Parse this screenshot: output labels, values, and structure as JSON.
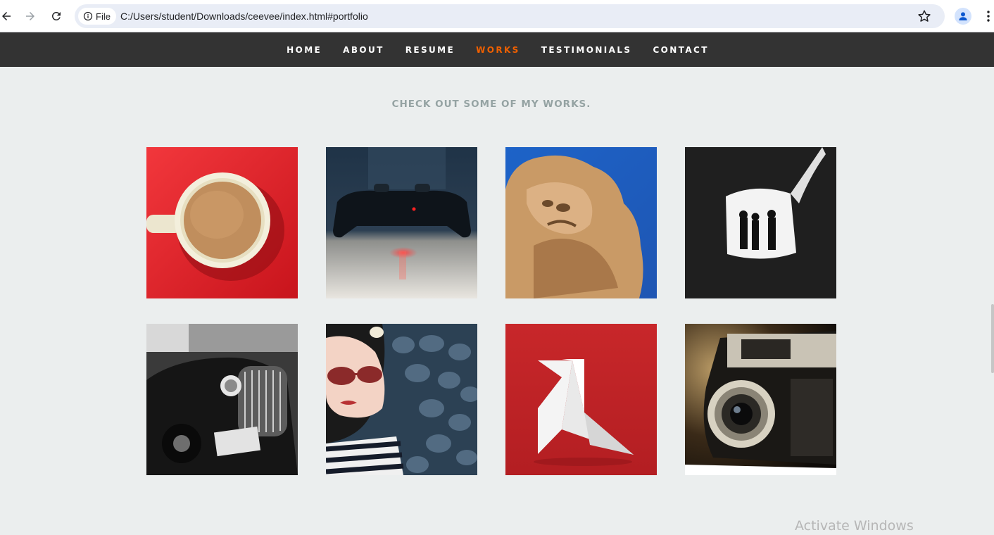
{
  "browser": {
    "chip_label": "File",
    "url": "C:/Users/student/Downloads/ceevee/index.html#portfolio"
  },
  "nav": {
    "items": [
      {
        "label": "Home",
        "active": false
      },
      {
        "label": "About",
        "active": false
      },
      {
        "label": "Resume",
        "active": false
      },
      {
        "label": "Works",
        "active": true
      },
      {
        "label": "Testimonials",
        "active": false
      },
      {
        "label": "Contact",
        "active": false
      }
    ],
    "accent_color": "#f06000"
  },
  "portfolio": {
    "heading": "CHECK OUT SOME OF MY WORKS.",
    "items": [
      {
        "name": "coffee"
      },
      {
        "name": "console"
      },
      {
        "name": "judah"
      },
      {
        "name": "into-the-light"
      },
      {
        "name": "farmerboy"
      },
      {
        "name": "girl"
      },
      {
        "name": "origami"
      },
      {
        "name": "retrocam"
      }
    ]
  },
  "os": {
    "watermark": "Activate Windows"
  }
}
